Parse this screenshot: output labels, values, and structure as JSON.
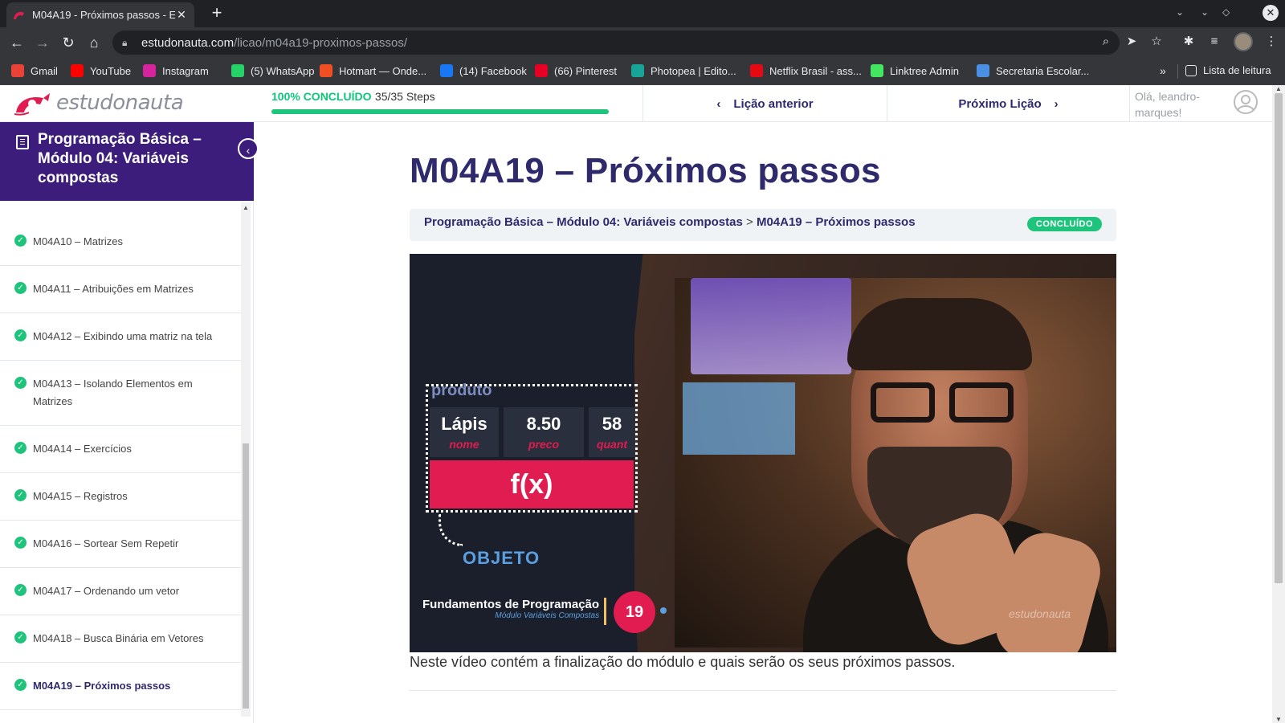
{
  "browser": {
    "tab_title": "M04A19 - Próximos passos - E",
    "url_host": "estudonauta.com",
    "url_path": "/licao/m04a19-proximos-passos/",
    "bookmarks": [
      {
        "label": "Gmail",
        "icon": "gmail-icon",
        "color": "#ea4335"
      },
      {
        "label": "YouTube",
        "icon": "youtube-icon",
        "color": "#ff0000"
      },
      {
        "label": "Instagram",
        "icon": "instagram-icon",
        "color": "#d6249f"
      },
      {
        "label": "(5) WhatsApp",
        "icon": "whatsapp-icon",
        "color": "#25d366"
      },
      {
        "label": "Hotmart — Onde...",
        "icon": "hotmart-icon",
        "color": "#f04e23"
      },
      {
        "label": "(14) Facebook",
        "icon": "facebook-icon",
        "color": "#1877f2"
      },
      {
        "label": "(66) Pinterest",
        "icon": "pinterest-icon",
        "color": "#e60023"
      },
      {
        "label": "Photopea | Edito...",
        "icon": "photopea-icon",
        "color": "#18a497"
      },
      {
        "label": "Netflix Brasil - ass...",
        "icon": "netflix-icon",
        "color": "#e50914"
      },
      {
        "label": "Linktree Admin",
        "icon": "linktree-icon",
        "color": "#43e660"
      },
      {
        "label": "Secretaria Escolar...",
        "icon": "secretaria-icon",
        "color": "#4a90e2"
      }
    ],
    "reading_list": "Lista de leitura"
  },
  "header": {
    "logo_text": "estudonauta",
    "progress_pct_label": "100% CONCLUÍDO",
    "progress_steps": "35/35 Steps",
    "progress_fraction": 1.0,
    "prev_label": "Lição anterior",
    "next_label": "Próximo Lição",
    "greeting": "Olá, leandro-marques!"
  },
  "sidebar": {
    "course_title": "Programação Básica – Módulo 04: Variáveis compostas",
    "items": [
      {
        "label": "M04A10 – Matrizes"
      },
      {
        "label": "M04A11 – Atribuições em Matrizes"
      },
      {
        "label": "M04A12 – Exibindo uma matriz na tela"
      },
      {
        "label": "M04A13 – Isolando Elementos em Matrizes"
      },
      {
        "label": "M04A14 – Exercícios"
      },
      {
        "label": "M04A15 – Registros"
      },
      {
        "label": "M04A16 – Sortear Sem Repetir"
      },
      {
        "label": "M04A17 – Ordenando um vetor"
      },
      {
        "label": "M04A18 – Busca Binária em Vetores"
      },
      {
        "label": "M04A19 – Próximos passos"
      }
    ]
  },
  "main": {
    "title": "M04A19 – Próximos passos",
    "breadcrumb_course": "Programação Básica – Módulo 04: Variáveis compostas",
    "breadcrumb_sep": ">",
    "breadcrumb_lesson": "M04A19 – Próximos passos",
    "status_badge": "CONCLUÍDO",
    "video": {
      "box_label": "produto",
      "cell1": "Lápis",
      "cell1_sub": "nome",
      "cell2": "8.50",
      "cell2_sub": "preco",
      "cell3": "58",
      "cell3_sub": "quant",
      "fx": "f(x)",
      "object_label": "OBJETO",
      "series_title": "Fundamentos de Programação",
      "series_sub": "Módulo Variáveis Compostas",
      "episode": "19",
      "watermark": "estudonauta"
    },
    "description": "Neste vídeo contém a finalização do módulo e quais serão os seus próximos passos."
  }
}
